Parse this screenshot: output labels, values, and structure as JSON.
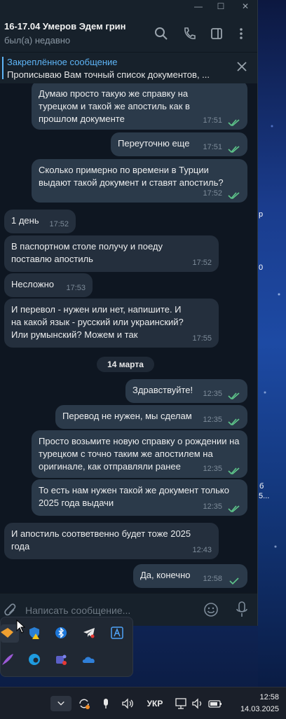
{
  "chat": {
    "title": "16-17.04 Умеров Эдем грин",
    "status": "был(а) недавно"
  },
  "pinned": {
    "title": "Закреплённое сообщение",
    "text": "Прописываю Вам точный список документов, ..."
  },
  "messages": [
    {
      "dir": "out",
      "text": "Думаю просто такую же справку на турецком и такой же апостиль как в прошлом документе",
      "time": "17:51"
    },
    {
      "dir": "out",
      "text": "Переуточню еще",
      "time": "17:51"
    },
    {
      "dir": "out",
      "text": "Сколько примерно по времени в Турции выдают такой документ и ставят апостиль?",
      "time": "17:52"
    },
    {
      "dir": "in",
      "text": "1 день",
      "time": "17:52"
    },
    {
      "dir": "in",
      "text": "В паспортном столе получу и поеду поставлю апостиль",
      "time": "17:52"
    },
    {
      "dir": "in",
      "text": "Несложно",
      "time": "17:53"
    },
    {
      "dir": "in",
      "text": "И перевол - нужен или нет, напишите. И на какой язык - русский или украинский? Или румынский? Можем и так",
      "time": "17:55"
    },
    {
      "dir": "out",
      "text": "Здравствуйте!",
      "time": "12:35"
    },
    {
      "dir": "out",
      "text": "Перевод не нужен, мы сделам",
      "time": "12:35"
    },
    {
      "dir": "out",
      "text": "Просто возьмите новую справку о рождении на турецком с точно таким же апостилем на оригинале, как отправляли ранее",
      "time": "12:35"
    },
    {
      "dir": "out",
      "text": "То есть нам нужен такой же документ только 2025 года выдачи",
      "time": "12:35"
    },
    {
      "dir": "in",
      "text": "И апостиль соответвенно будет тоже 2025 года",
      "time": "12:43"
    },
    {
      "dir": "out",
      "text": "Да, конечно",
      "time": "12:58"
    }
  ],
  "date_separator": "14 марта",
  "composer": {
    "placeholder": "Написать сообщение..."
  },
  "taskbar": {
    "language": "УКР",
    "time": "12:58",
    "date": "14.03.2025"
  },
  "wallpaper_text": [
    "р",
    "0",
    "б",
    "5..."
  ],
  "colors": {
    "accent": "#5eb5f7",
    "check": "#5ec58a"
  }
}
